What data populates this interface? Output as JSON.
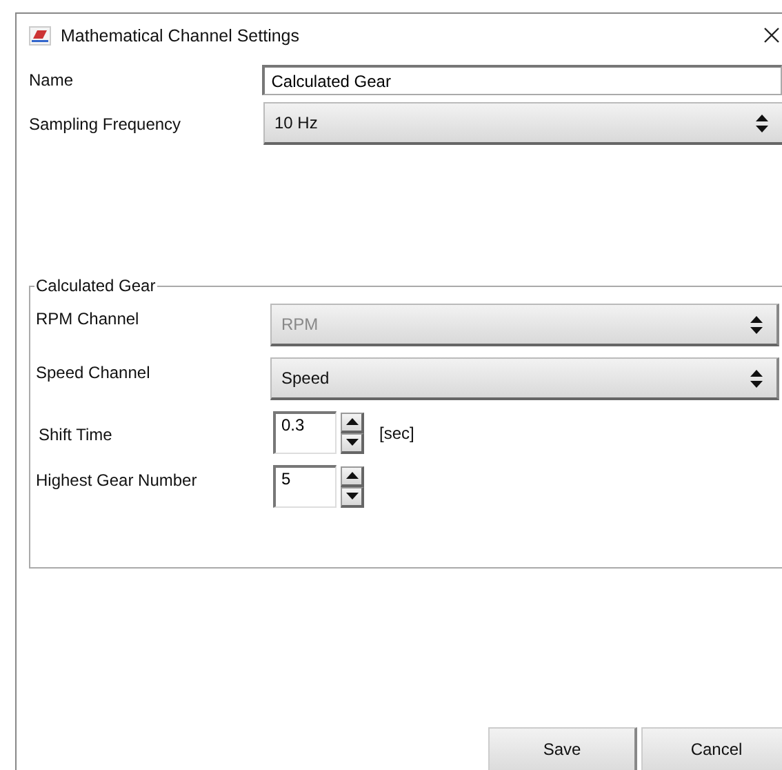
{
  "window": {
    "title": "Mathematical Channel Settings"
  },
  "fields": [
    {
      "label": "Name",
      "kind": "text",
      "value": "Calculated Gear"
    },
    {
      "label": "Sampling Frequency",
      "kind": "select",
      "value": "10 Hz"
    }
  ],
  "group": {
    "title": "Calculated Gear",
    "rows": [
      {
        "label": "RPM Channel",
        "kind": "select",
        "value": "RPM",
        "disabled": true
      },
      {
        "label": "Speed Channel",
        "kind": "select",
        "value": "Speed",
        "disabled": false
      },
      {
        "label": "Shift Time",
        "kind": "spinner",
        "value": "0.3",
        "unit": "[sec]"
      },
      {
        "label": "Highest Gear Number",
        "kind": "spinner",
        "value": "5"
      }
    ]
  },
  "buttons": [
    "Save",
    "Cancel"
  ]
}
